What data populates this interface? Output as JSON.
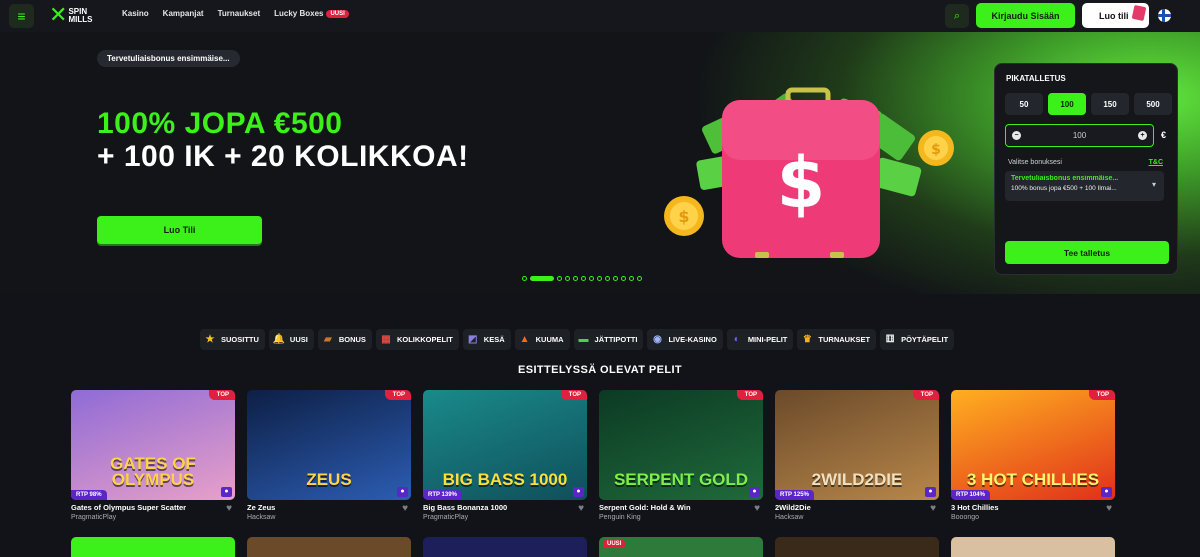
{
  "header": {
    "logo_line1": "SPIN",
    "logo_line2": "MILLS",
    "nav": [
      {
        "label": "Kasino"
      },
      {
        "label": "Kampanjat"
      },
      {
        "label": "Turnaukset"
      },
      {
        "label": "Lucky Boxes",
        "badge": "UUSI"
      }
    ],
    "login_label": "Kirjaudu Sisään",
    "signup_label": "Luo tili",
    "menu_icon": "menu-icon",
    "search_icon": "search-icon",
    "flag_icon": "finland-flag-icon"
  },
  "hero": {
    "promo_tag": "Tervetuliaisbonus ensimmäise...",
    "headline_green": "100% JOPA €500",
    "headline_white": "+ 100 IK + 20 KOLIKKOA!",
    "cta_label": "Luo Tili",
    "slides_total": 13,
    "slide_active": 2
  },
  "quick_deposit": {
    "title": "PIKATALLETUS",
    "amounts": [
      "50",
      "100",
      "150",
      "500"
    ],
    "selected_amount": "100",
    "amount_value": "100",
    "currency": "€",
    "bonus_label": "Valitse bonuksesi",
    "tc_label": "T&C",
    "bonus_title": "Tervetuliaisbonus ensimmäise...",
    "bonus_desc": "100% bonus jopa €500 + 100 Ilmai...",
    "deposit_button": "Tee talletus"
  },
  "categories": [
    {
      "label": "SUOSITTU",
      "icon": "star-icon",
      "glyph": "★",
      "color": "#f5c518"
    },
    {
      "label": "UUSI",
      "icon": "bell-icon",
      "glyph": "🔔",
      "color": "#f5b800"
    },
    {
      "label": "BONUS",
      "icon": "chest-icon",
      "glyph": "▰",
      "color": "#c7782c"
    },
    {
      "label": "KOLIKKOPELIT",
      "icon": "slot-machine-icon",
      "glyph": "▦",
      "color": "#e04848"
    },
    {
      "label": "KESÄ",
      "icon": "summer-icon",
      "glyph": "◩",
      "color": "#8a7fe0"
    },
    {
      "label": "KUUMA",
      "icon": "fire-icon",
      "glyph": "▲",
      "color": "#ff6a1a"
    },
    {
      "label": "JÄTTIPOTTI",
      "icon": "money-icon",
      "glyph": "▬",
      "color": "#4fcf4f"
    },
    {
      "label": "LIVE-KASINO",
      "icon": "live-icon",
      "glyph": "◉",
      "color": "#9fb4ff"
    },
    {
      "label": "MINI-PELIT",
      "icon": "mini-games-icon",
      "glyph": "◐",
      "color": "#7c5cff"
    },
    {
      "label": "TURNAUKSET",
      "icon": "trophy-icon",
      "glyph": "♛",
      "color": "#f0b020"
    },
    {
      "label": "PÖYTÄPELIT",
      "icon": "dice-icon",
      "glyph": "⚅",
      "color": "#e8e8e8"
    }
  ],
  "featured": {
    "title": "ESITTELYSSÄ OLEVAT PELIT",
    "games": [
      {
        "name": "Gates of Olympus Super Scatter",
        "provider": "PragmaticPlay",
        "badge": "TOP",
        "rtp": "RTP 98%",
        "art_title": "GATES OF OLYMPUS",
        "colors": [
          "#8f6bd6",
          "#e8a0c8"
        ],
        "art_color": "#ffd24a"
      },
      {
        "name": "Ze Zeus",
        "provider": "Hacksaw",
        "badge": "TOP",
        "rtp": "",
        "art_title": "ZEUS",
        "colors": [
          "#0d1f45",
          "#2c5db3"
        ],
        "art_color": "#ffd24a"
      },
      {
        "name": "Big Bass Bonanza 1000",
        "provider": "PragmaticPlay",
        "badge": "TOP",
        "rtp": "RTP 139%",
        "art_title": "BIG BASS 1000",
        "colors": [
          "#1a8a8a",
          "#0f4f5a"
        ],
        "art_color": "#ffde3a"
      },
      {
        "name": "Serpent Gold: Hold & Win",
        "provider": "Penguin King",
        "badge": "TOP",
        "rtp": "",
        "art_title": "SERPENT GOLD",
        "colors": [
          "#0c3a24",
          "#1f6a3a"
        ],
        "art_color": "#7cf04a"
      },
      {
        "name": "2Wild2Die",
        "provider": "Hacksaw",
        "badge": "TOP",
        "rtp": "RTP 125%",
        "art_title": "2WILD2DIE",
        "colors": [
          "#6b4a2a",
          "#b8874a"
        ],
        "art_color": "#f0e0c0"
      },
      {
        "name": "3 Hot Chillies",
        "provider": "Booongo",
        "badge": "TOP",
        "rtp": "RTP 104%",
        "art_title": "3 HOT CHILLIES",
        "colors": [
          "#ffb020",
          "#e0301a"
        ],
        "art_color": "#fff36a"
      }
    ]
  },
  "next_row": {
    "new_badge": "UUSI",
    "colors": [
      "#3cf01a",
      "#6b4a2a",
      "#1d1f5a",
      "#2e7a3a",
      "#3a2a1a",
      "#d9c0a0"
    ]
  }
}
